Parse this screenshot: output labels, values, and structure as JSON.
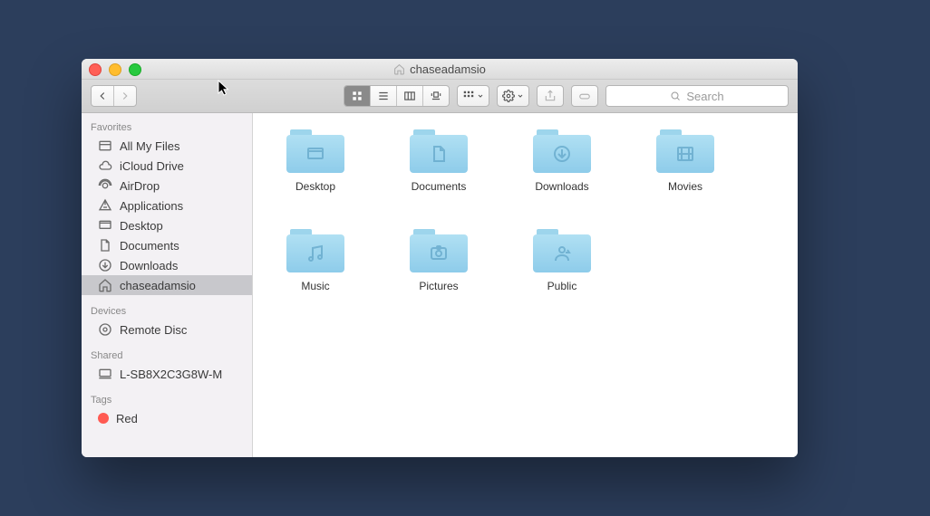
{
  "window": {
    "title": "chaseadamsio"
  },
  "toolbar": {
    "search_placeholder": "Search"
  },
  "sidebar": {
    "favorites_header": "Favorites",
    "favorites": [
      {
        "label": "All My Files",
        "icon": "all-my-files-icon"
      },
      {
        "label": "iCloud Drive",
        "icon": "cloud-icon"
      },
      {
        "label": "AirDrop",
        "icon": "airdrop-icon"
      },
      {
        "label": "Applications",
        "icon": "applications-icon"
      },
      {
        "label": "Desktop",
        "icon": "desktop-icon"
      },
      {
        "label": "Documents",
        "icon": "documents-icon"
      },
      {
        "label": "Downloads",
        "icon": "downloads-icon"
      },
      {
        "label": "chaseadamsio",
        "icon": "home-icon",
        "selected": true
      }
    ],
    "devices_header": "Devices",
    "devices": [
      {
        "label": "Remote Disc",
        "icon": "disc-icon"
      }
    ],
    "shared_header": "Shared",
    "shared": [
      {
        "label": "L-SB8X2C3G8W-M",
        "icon": "computer-icon"
      }
    ],
    "tags_header": "Tags",
    "tags": [
      {
        "label": "Red",
        "color": "#ff5a52"
      }
    ]
  },
  "folders": [
    {
      "name": "Desktop",
      "glyph": "desktop"
    },
    {
      "name": "Documents",
      "glyph": "document"
    },
    {
      "name": "Downloads",
      "glyph": "download"
    },
    {
      "name": "Movies",
      "glyph": "movie"
    },
    {
      "name": "Music",
      "glyph": "music"
    },
    {
      "name": "Pictures",
      "glyph": "picture"
    },
    {
      "name": "Public",
      "glyph": "public"
    }
  ]
}
